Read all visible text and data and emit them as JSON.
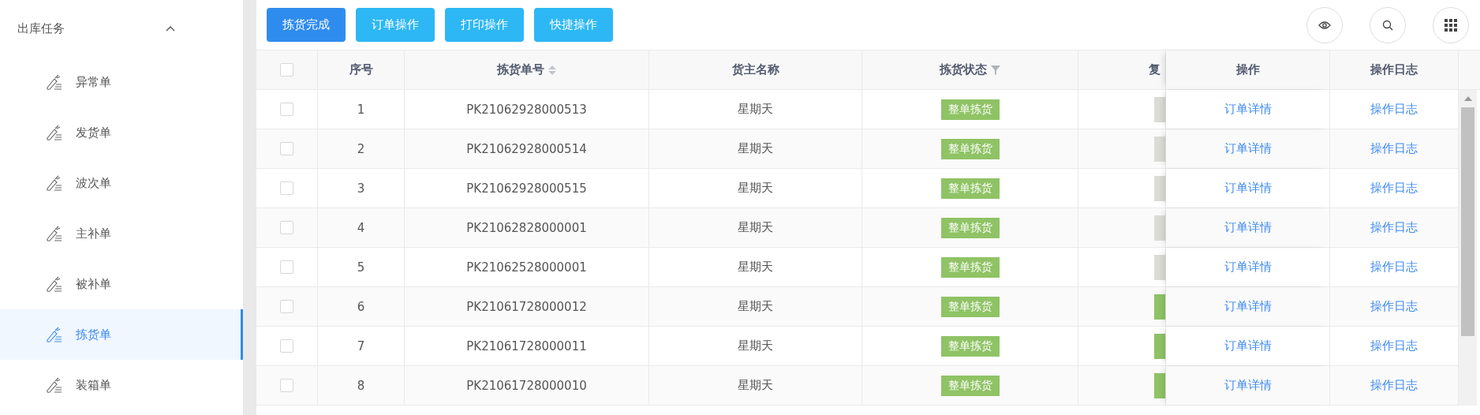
{
  "sidebar": {
    "group": {
      "title": "出库任务",
      "expanded": true
    },
    "items": [
      {
        "label": "异常单",
        "selected": false
      },
      {
        "label": "发货单",
        "selected": false
      },
      {
        "label": "波次单",
        "selected": false
      },
      {
        "label": "主补单",
        "selected": false
      },
      {
        "label": "被补单",
        "selected": false
      },
      {
        "label": "拣货单",
        "selected": true
      },
      {
        "label": "装箱单",
        "selected": false
      }
    ]
  },
  "toolbar": {
    "buttons": [
      {
        "label": "拣货完成",
        "kind": "primary"
      },
      {
        "label": "订单操作",
        "kind": "info"
      },
      {
        "label": "打印操作",
        "kind": "info"
      },
      {
        "label": "快捷操作",
        "kind": "info"
      }
    ]
  },
  "table": {
    "select_all": {
      "checked": false
    },
    "columns": [
      {
        "label": "序号",
        "sortable": false,
        "filterable": false
      },
      {
        "label": "拣货单号",
        "sortable": true,
        "filterable": false
      },
      {
        "label": "货主名称",
        "sortable": false,
        "filterable": false
      },
      {
        "label": "拣货状态",
        "sortable": false,
        "filterable": true
      },
      {
        "label": "复",
        "sortable": false,
        "filterable": false
      },
      {
        "label": "操作",
        "sortable": false,
        "filterable": false
      },
      {
        "label": "操作日志",
        "sortable": false,
        "filterable": false
      }
    ],
    "rows": [
      {
        "checked": false,
        "index": "1",
        "pick_no": "PK21062928000513",
        "owner": "星期天",
        "pick_status": "整单拣货",
        "review_tag": {
          "color": "#dcdcd7"
        },
        "action": "订单详情",
        "log": "操作日志"
      },
      {
        "checked": false,
        "index": "2",
        "pick_no": "PK21062928000514",
        "owner": "星期天",
        "pick_status": "整单拣货",
        "review_tag": {
          "color": "#dcdcd7"
        },
        "action": "订单详情",
        "log": "操作日志"
      },
      {
        "checked": false,
        "index": "3",
        "pick_no": "PK21062928000515",
        "owner": "星期天",
        "pick_status": "整单拣货",
        "review_tag": {
          "color": "#dcdcd7"
        },
        "action": "订单详情",
        "log": "操作日志"
      },
      {
        "checked": false,
        "index": "4",
        "pick_no": "PK21062828000001",
        "owner": "星期天",
        "pick_status": "整单拣货",
        "review_tag": {
          "color": "#dcdcd7"
        },
        "action": "订单详情",
        "log": "操作日志"
      },
      {
        "checked": false,
        "index": "5",
        "pick_no": "PK21062528000001",
        "owner": "星期天",
        "pick_status": "整单拣货",
        "review_tag": {
          "color": "#dcdcd7"
        },
        "action": "订单详情",
        "log": "操作日志"
      },
      {
        "checked": false,
        "index": "6",
        "pick_no": "PK21061728000012",
        "owner": "星期天",
        "pick_status": "整单拣货",
        "review_tag": {
          "color": "#8fc365"
        },
        "action": "订单详情",
        "log": "操作日志"
      },
      {
        "checked": false,
        "index": "7",
        "pick_no": "PK21061728000011",
        "owner": "星期天",
        "pick_status": "整单拣货",
        "review_tag": {
          "color": "#8fc365"
        },
        "action": "订单详情",
        "log": "操作日志"
      },
      {
        "checked": false,
        "index": "8",
        "pick_no": "PK21061728000010",
        "owner": "星期天",
        "pick_status": "整单拣货",
        "review_tag": {
          "color": "#8fc365"
        },
        "action": "订单详情",
        "log": "操作日志"
      }
    ]
  }
}
